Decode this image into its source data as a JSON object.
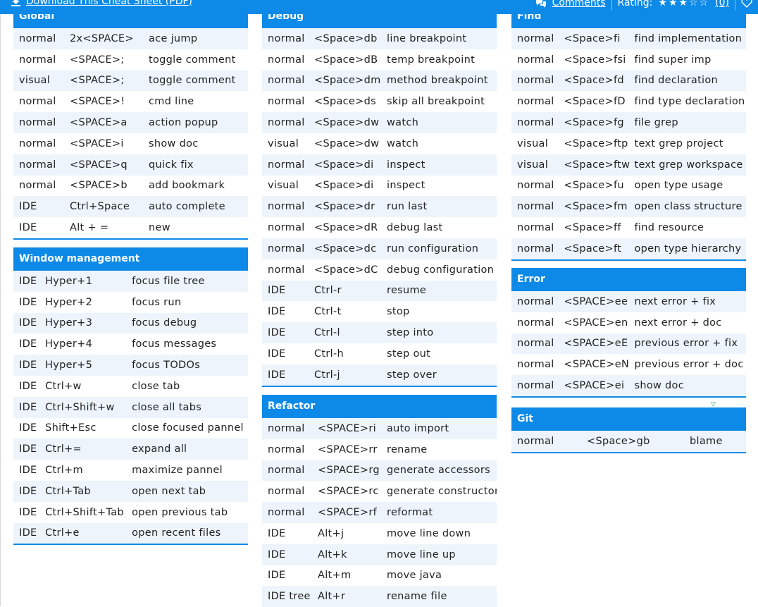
{
  "topbar": {
    "download_label": "Download This Cheat Sheet (PDF)",
    "comments_label": "Comments",
    "rating_label": "Rating:",
    "stars": "★★★☆☆",
    "rating_count": "(0)"
  },
  "colors": {
    "accent": "#0d8ae8",
    "stripe": "#edf4fb"
  },
  "sections": {
    "global": {
      "title": "Global",
      "rows": [
        [
          "normal",
          "2x<SPACE>",
          "ace jump"
        ],
        [
          "normal",
          "<SPACE>;",
          "toggle comment"
        ],
        [
          "visual",
          "<SPACE>;",
          "toggle comment"
        ],
        [
          "normal",
          "<SPACE>!",
          "cmd line"
        ],
        [
          "normal",
          "<SPACE>a",
          "action popup"
        ],
        [
          "normal",
          "<SPACE>i",
          "show doc"
        ],
        [
          "normal",
          "<SPACE>q",
          "quick fix"
        ],
        [
          "normal",
          "<SPACE>b",
          "add bookmark"
        ],
        [
          "IDE",
          "Ctrl+Space",
          "auto complete"
        ],
        [
          "IDE",
          "Alt + =",
          "new"
        ]
      ]
    },
    "window": {
      "title": "Window management",
      "rows": [
        [
          "IDE",
          "Hyper+1",
          "focus file tree"
        ],
        [
          "IDE",
          "Hyper+2",
          "focus run"
        ],
        [
          "IDE",
          "Hyper+3",
          "focus debug"
        ],
        [
          "IDE",
          "Hyper+4",
          "focus messages"
        ],
        [
          "IDE",
          "Hyper+5",
          "focus TODOs"
        ],
        [
          "IDE",
          "Ctrl+w",
          "close tab"
        ],
        [
          "IDE",
          "Ctrl+Shift+w",
          "close all tabs"
        ],
        [
          "IDE",
          "Shift+Esc",
          "close focused pannel"
        ],
        [
          "IDE",
          "Ctrl+=",
          "expand all"
        ],
        [
          "IDE",
          "Ctrl+m",
          "maximize pannel"
        ],
        [
          "IDE",
          "Ctrl+Tab",
          "open next tab"
        ],
        [
          "IDE",
          "Ctrl+Shift+Tab",
          "open previous tab"
        ],
        [
          "IDE",
          "Ctrl+e",
          "open recent files"
        ]
      ]
    },
    "debug": {
      "title": "Debug",
      "rows": [
        [
          "normal",
          "<Space>db",
          "line breakpoint"
        ],
        [
          "normal",
          "<Space>dB",
          "temp breakpoint"
        ],
        [
          "normal",
          "<Space>dm",
          "method breakpoint"
        ],
        [
          "normal",
          "<Space>ds",
          "skip all breakpoint"
        ],
        [
          "normal",
          "<Space>dw",
          "watch"
        ],
        [
          "visual",
          "<Space>dw",
          "watch"
        ],
        [
          "normal",
          "<Space>di",
          "inspect"
        ],
        [
          "visual",
          "<Space>di",
          "inspect"
        ],
        [
          "normal",
          "<Space>dr",
          "run last"
        ],
        [
          "normal",
          "<Space>dR",
          "debug last"
        ],
        [
          "normal",
          "<Space>dc",
          "run configuration"
        ],
        [
          "normal",
          "<Space>dC",
          "debug configuration"
        ],
        [
          "IDE",
          "Ctrl-r",
          "resume"
        ],
        [
          "IDE",
          "Ctrl-t",
          "stop"
        ],
        [
          "IDE",
          "Ctrl-l",
          "step into"
        ],
        [
          "IDE",
          "Ctrl-h",
          "step out"
        ],
        [
          "IDE",
          "Ctrl-j",
          "step over"
        ]
      ]
    },
    "refactor": {
      "title": "Refactor",
      "rows": [
        [
          "normal",
          "<SPACE>ri",
          "auto import"
        ],
        [
          "normal",
          "<SPACE>rr",
          "rename"
        ],
        [
          "normal",
          "<SPACE>rg",
          "generate accessors"
        ],
        [
          "normal",
          "<SPACE>rc",
          "generate constructor"
        ],
        [
          "normal",
          "<SPACE>rf",
          "reformat"
        ],
        [
          "IDE",
          "Alt+j",
          "move line down"
        ],
        [
          "IDE",
          "Alt+k",
          "move line up"
        ],
        [
          "IDE",
          "Alt+m",
          "move java"
        ],
        [
          "IDE tree",
          "Alt+r",
          "rename file"
        ]
      ]
    },
    "find": {
      "title": "Find",
      "rows": [
        [
          "normal",
          "<Space>fi",
          "find implementation"
        ],
        [
          "normal",
          "<Space>fsi",
          "find super imp"
        ],
        [
          "normal",
          "<Space>fd",
          "find declaration"
        ],
        [
          "normal",
          "<Space>fD",
          "find type declaration"
        ],
        [
          "normal",
          "<Space>fg",
          "file grep"
        ],
        [
          "visual",
          "<Space>ftp",
          "text grep project"
        ],
        [
          "visual",
          "<Space>ftw",
          "text grep workspace"
        ],
        [
          "normal",
          "<Space>fu",
          "open type usage"
        ],
        [
          "normal",
          "<Space>fm",
          "open class structure"
        ],
        [
          "normal",
          "<Space>ff",
          "find resource"
        ],
        [
          "normal",
          "<Space>ft",
          "open type hierarchy"
        ]
      ]
    },
    "error": {
      "title": "Error",
      "rows": [
        [
          "normal",
          "<SPACE>ee",
          "next error + fix"
        ],
        [
          "normal",
          "<SPACE>en",
          "next error + doc"
        ],
        [
          "normal",
          "<SPACE>eE",
          "previous error + fix"
        ],
        [
          "normal",
          "<SPACE>eN",
          "previous error + doc"
        ],
        [
          "normal",
          "<SPACE>ei",
          "show doc"
        ]
      ]
    },
    "git": {
      "title": "Git",
      "rows": [
        [
          "normal",
          "<Space>gb",
          "blame"
        ]
      ]
    }
  }
}
